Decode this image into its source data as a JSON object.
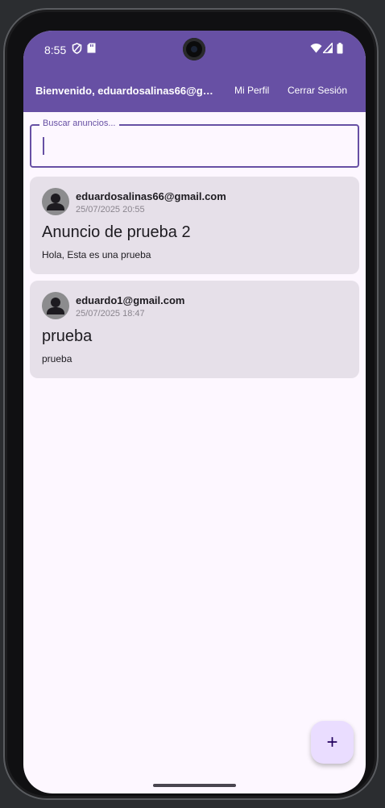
{
  "status_bar": {
    "time": "8:55",
    "icons": [
      "shield-icon",
      "sd-card-icon",
      "wifi-icon",
      "signal-icon",
      "battery-icon"
    ]
  },
  "app_bar": {
    "title": "Bienvenido, eduardosalinas66@gm...",
    "profile_label": "Mi Perfil",
    "logout_label": "Cerrar Sesión"
  },
  "search": {
    "label": "Buscar anuncios...",
    "value": ""
  },
  "posts": [
    {
      "email": "eduardosalinas66@gmail.com",
      "date": "25/07/2025 20:55",
      "title": "Anuncio de prueba 2",
      "body": "Hola, Esta es una prueba"
    },
    {
      "email": "eduardo1@gmail.com",
      "date": "25/07/2025 18:47",
      "title": "prueba",
      "body": "prueba"
    }
  ],
  "fab": {
    "icon": "plus-icon",
    "symbol": "+"
  },
  "colors": {
    "primary": "#6750a4",
    "background": "#fdf7ff",
    "card": "#e6e0e9",
    "fab": "#eaddff"
  }
}
